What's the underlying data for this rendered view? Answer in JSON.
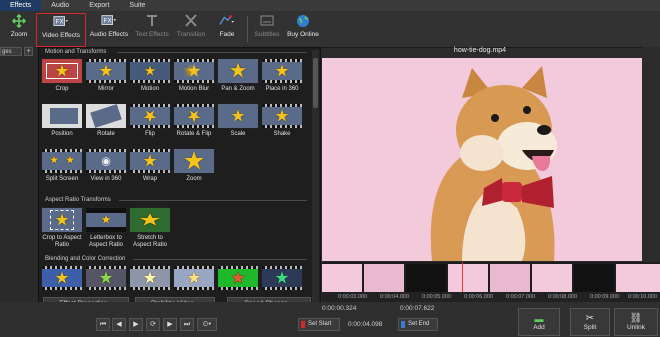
{
  "menu": [
    {
      "label": "Effects",
      "active": true
    },
    {
      "label": "Audio",
      "active": false
    },
    {
      "label": "Export",
      "active": false
    },
    {
      "label": "Suite",
      "active": false
    }
  ],
  "toolbar": {
    "zoom": "Zoom",
    "video_effects": "Video Effects",
    "audio_effects": "Audio Effects",
    "text_effects": "Text Effects",
    "transition": "Transition",
    "fade": "Fade",
    "subtitles": "Subtitles",
    "buy_online": "Buy Online"
  },
  "left_tab": {
    "label": "ges",
    "plus": "+"
  },
  "panel": {
    "section_motion": "Motion and Transforms",
    "motion_tiles": [
      "Crop",
      "Mirror",
      "Motion",
      "Motion Blur",
      "Pan & Zoom",
      "Place in 360",
      "Position",
      "Rotate",
      "Flip",
      "Rotate & Flip",
      "Scale",
      "Shake",
      "Split Screen",
      "View in 360",
      "Wrap",
      "Zoom"
    ],
    "section_aspect": "Aspect Ratio Transforms",
    "aspect_tiles": [
      "Crop to Aspect Ratio",
      "Letterbox to Aspect Ratio",
      "Stretch to Aspect Ratio"
    ],
    "section_blend": "Blending and Color Correction",
    "buttons": {
      "effect_properties": "Effect Properties...",
      "stabilize": "Stabilize Video...",
      "speed": "Speed Change..."
    }
  },
  "preview": {
    "title": "how-tie-dog.mp4"
  },
  "timeline": {
    "ticks": [
      "0:00:03.000",
      "0:00:04.000",
      "0:00:05.000",
      "0:00:06.000",
      "0:00:07.000",
      "0:00:08.000",
      "0:00:09.000",
      "0:00:10.000"
    ]
  },
  "bottom": {
    "time_left": "0:00:00.324",
    "time_mid": "0:00:04.098",
    "time_right": "0:00:07.622",
    "set_start": "Set Start",
    "set_end": "Set End",
    "add": "Add",
    "split": "Split",
    "unlink": "Unlink"
  },
  "colors": {
    "accent": "#1f3b63",
    "selection": "#d8282e",
    "star": "#f3c21b",
    "preview_bg": "#f3c9dc"
  }
}
